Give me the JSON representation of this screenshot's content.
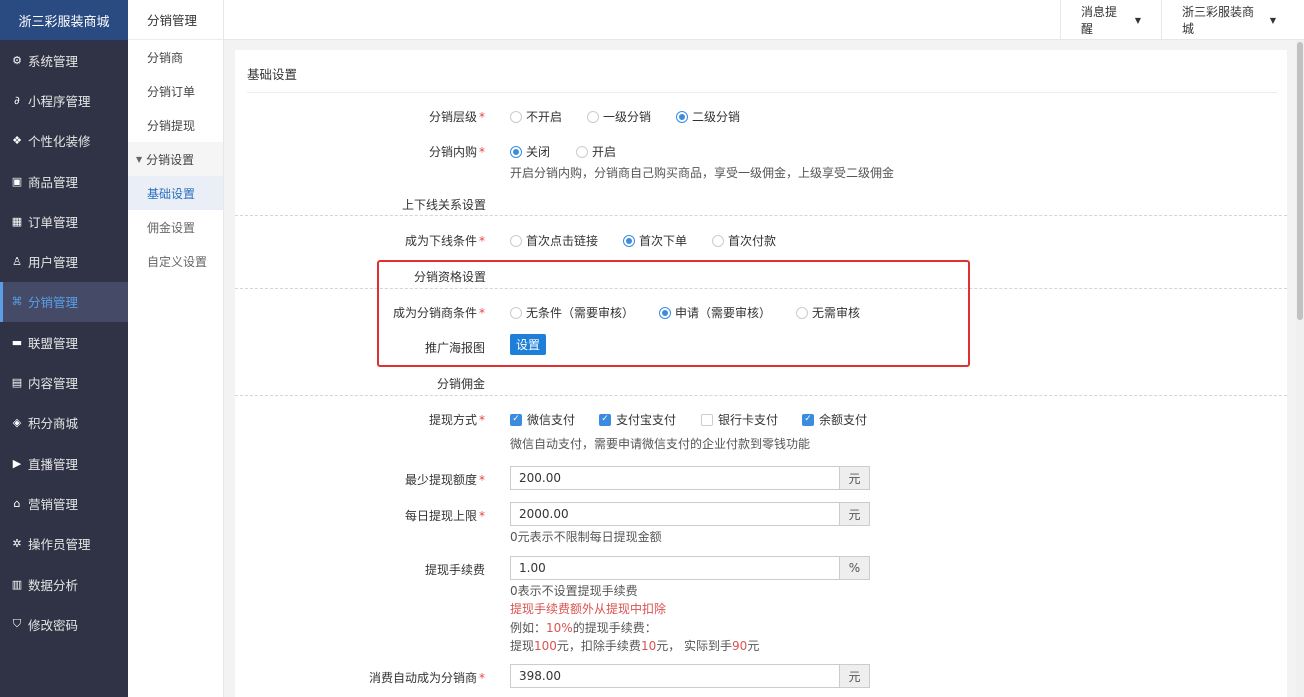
{
  "sidebar": {
    "brand": "浙三彩服装商城",
    "items": [
      {
        "label": "系统管理",
        "icon": "gear-icon",
        "glyph": "⚙"
      },
      {
        "label": "小程序管理",
        "icon": "link-icon",
        "glyph": "∂"
      },
      {
        "label": "个性化装修",
        "icon": "brush-icon",
        "glyph": "❖"
      },
      {
        "label": "商品管理",
        "icon": "box-icon",
        "glyph": "▣"
      },
      {
        "label": "订单管理",
        "icon": "calendar-icon",
        "glyph": "▦"
      },
      {
        "label": "用户管理",
        "icon": "user-icon",
        "glyph": "♙"
      },
      {
        "label": "分销管理",
        "icon": "sitemap-icon",
        "glyph": "⌘"
      },
      {
        "label": "联盟管理",
        "icon": "card-icon",
        "glyph": "▬"
      },
      {
        "label": "内容管理",
        "icon": "news-icon",
        "glyph": "▤"
      },
      {
        "label": "积分商城",
        "icon": "cube-icon",
        "glyph": "◈"
      },
      {
        "label": "直播管理",
        "icon": "play-icon",
        "glyph": "▶"
      },
      {
        "label": "营销管理",
        "icon": "shop-icon",
        "glyph": "⌂"
      },
      {
        "label": "操作员管理",
        "icon": "cog-icon",
        "glyph": "✲"
      },
      {
        "label": "数据分析",
        "icon": "chart-icon",
        "glyph": "▥"
      },
      {
        "label": "修改密码",
        "icon": "shield-icon",
        "glyph": "⛉"
      }
    ],
    "active_index": 6
  },
  "subnav": {
    "title": "分销管理",
    "items": [
      "分销商",
      "分销订单",
      "分销提现"
    ],
    "group": "分销设置",
    "children": [
      "基础设置",
      "佣金设置",
      "自定义设置"
    ],
    "active_child": 0
  },
  "topbar": {
    "notice": "消息提醒",
    "store": "浙三彩服装商城"
  },
  "panel": {
    "title": "基础设置",
    "level": {
      "label": "分销层级",
      "options": [
        "不开启",
        "一级分销",
        "二级分销"
      ],
      "selected": 2
    },
    "self_buy": {
      "label": "分销内购",
      "options": [
        "关闭",
        "开启"
      ],
      "selected": 0,
      "help": "开启分销内购，分销商自己购买商品，享受一级佣金，上级享受二级佣金"
    },
    "relation_section": "上下线关系设置",
    "downline": {
      "label": "成为下线条件",
      "options": [
        "首次点击链接",
        "首次下单",
        "首次付款"
      ],
      "selected": 1
    },
    "qualify_section": "分销资格设置",
    "become": {
      "label": "成为分销商条件",
      "options": [
        "无条件（需要审核）",
        "申请（需要审核）",
        "无需审核"
      ],
      "selected": 1
    },
    "poster": {
      "label": "推广海报图",
      "button": "设置"
    },
    "commission_section": "分销佣金",
    "withdraw": {
      "label": "提现方式",
      "options": [
        "微信支付",
        "支付宝支付",
        "银行卡支付",
        "余额支付"
      ],
      "checked": [
        true,
        true,
        false,
        true
      ],
      "help": "微信自动支付，需要申请微信支付的企业付款到零钱功能"
    },
    "min_withdraw": {
      "label": "最少提现额度",
      "value": "200.00",
      "unit": "元"
    },
    "daily_limit": {
      "label": "每日提现上限",
      "value": "2000.00",
      "unit": "元",
      "help": "0元表示不限制每日提现金额"
    },
    "fee": {
      "label": "提现手续费",
      "value": "1.00",
      "unit": "%",
      "help1": "0表示不设置提现手续费",
      "help2": "提现手续费额外从提现中扣除",
      "example_prefix": "例如：",
      "example_pct": "10%",
      "example_suffix": "的提现手续费：",
      "calc_a": "提现",
      "calc_b": "100",
      "calc_c": "元，扣除手续费",
      "calc_d": "10",
      "calc_e": "元， 实际到手",
      "calc_f": "90",
      "calc_g": "元"
    },
    "auto_become": {
      "label": "消费自动成为分销商",
      "value": "398.00",
      "unit": "元"
    }
  },
  "colors": {
    "sidebar_bg": "#2f3345",
    "brand_bg": "#2a4a82",
    "accent": "#3b8be0",
    "button": "#1e7fd8",
    "highlight": "#e03030"
  }
}
